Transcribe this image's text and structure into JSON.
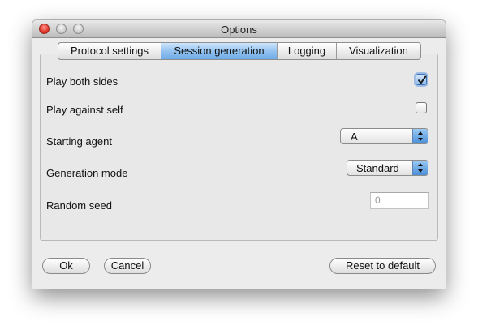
{
  "window": {
    "title": "Options"
  },
  "tabs": [
    {
      "label": "Protocol settings",
      "selected": false
    },
    {
      "label": "Session generation",
      "selected": true
    },
    {
      "label": "Logging",
      "selected": false
    },
    {
      "label": "Visualization",
      "selected": false
    }
  ],
  "settings": {
    "play_both_sides": {
      "label": "Play both sides",
      "checked": true
    },
    "play_against_self": {
      "label": "Play against self",
      "checked": false
    },
    "starting_agent": {
      "label": "Starting agent",
      "value": "A"
    },
    "generation_mode": {
      "label": "Generation mode",
      "value": "Standard"
    },
    "random_seed": {
      "label": "Random seed",
      "value": "0"
    }
  },
  "buttons": {
    "ok": "Ok",
    "cancel": "Cancel",
    "reset": "Reset to default"
  },
  "colors": {
    "selected_tab": "#8fc0ef",
    "close_button": "#e0362b",
    "popup_arrows": "#4b8fd8"
  },
  "icons": {
    "close": "close-icon",
    "minimize": "minimize-icon",
    "zoom": "zoom-icon",
    "checkmark": "checkmark-icon",
    "popup_arrows": "chevron-updown-icon"
  }
}
